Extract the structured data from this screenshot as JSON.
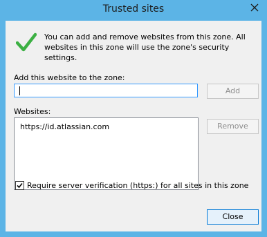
{
  "window": {
    "title": "Trusted sites"
  },
  "info": {
    "message": "You can add and remove websites from this zone. All websites in this zone will use the zone's security settings."
  },
  "add_site": {
    "label": "Add this website to the zone:",
    "value": "",
    "button_label": "Add"
  },
  "websites": {
    "label": "Websites:",
    "items": [
      "https://id.atlassian.com"
    ],
    "remove_label": "Remove"
  },
  "verification": {
    "label": "Require server verification (https:) for all sites in this zone",
    "checked": true
  },
  "footer": {
    "close_label": "Close"
  },
  "icons": {
    "info_icon": "green-checkmark-icon",
    "title_close": "close-icon"
  },
  "colors": {
    "titlebar": "#5cb4e6",
    "checkmark": "#3cb043",
    "focus_border": "#3399ff"
  }
}
